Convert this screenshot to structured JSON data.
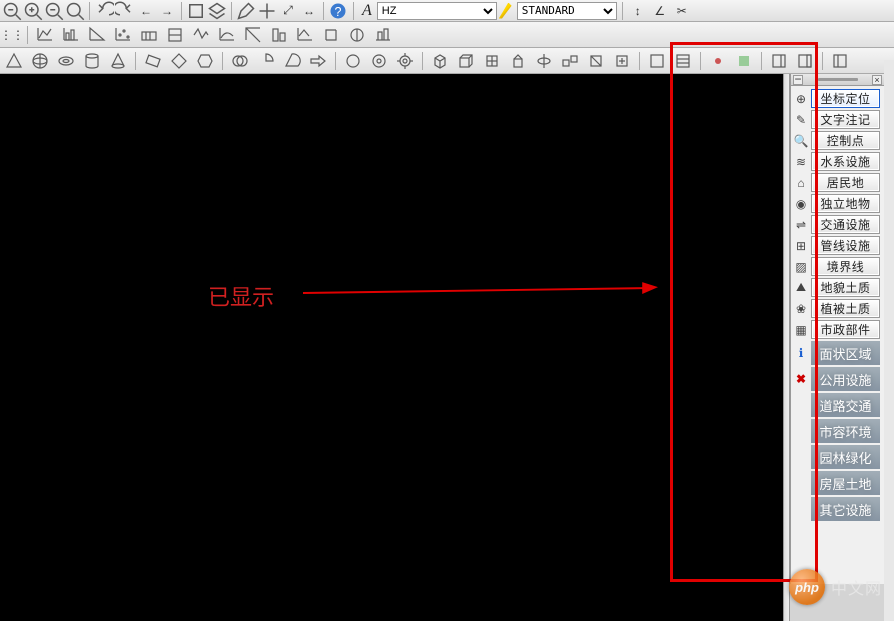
{
  "top": {
    "font_combo": {
      "value": "HZ"
    },
    "style_combo": {
      "value": "STANDARD"
    }
  },
  "annotation": {
    "label": "已显示"
  },
  "watermark": {
    "badge": "php",
    "text": "中文网"
  },
  "panel": {
    "items": [
      {
        "icon": "target",
        "label": "坐标定位",
        "active": true
      },
      {
        "icon": "text",
        "label": "文字注记"
      },
      {
        "icon": "search",
        "label": "控制点"
      },
      {
        "icon": "water",
        "label": "水系设施"
      },
      {
        "icon": "house",
        "label": "居民地"
      },
      {
        "icon": "point",
        "label": "独立地物"
      },
      {
        "icon": "road",
        "label": "交通设施"
      },
      {
        "icon": "pipe",
        "label": "管线设施"
      },
      {
        "icon": "border",
        "label": "境界线"
      },
      {
        "icon": "terrain",
        "label": "地貌土质"
      },
      {
        "icon": "plant",
        "label": "植被土质"
      },
      {
        "icon": "grid",
        "label": "市政部件"
      }
    ],
    "labels": [
      {
        "icon": "info",
        "text": "面状区域"
      },
      {
        "icon": "close",
        "text": "公用设施"
      },
      {
        "icon": "",
        "text": "道路交通"
      },
      {
        "icon": "",
        "text": "市容环境"
      },
      {
        "icon": "",
        "text": "园林绿化"
      },
      {
        "icon": "",
        "text": "房屋土地"
      },
      {
        "icon": "",
        "text": "其它设施"
      }
    ]
  }
}
